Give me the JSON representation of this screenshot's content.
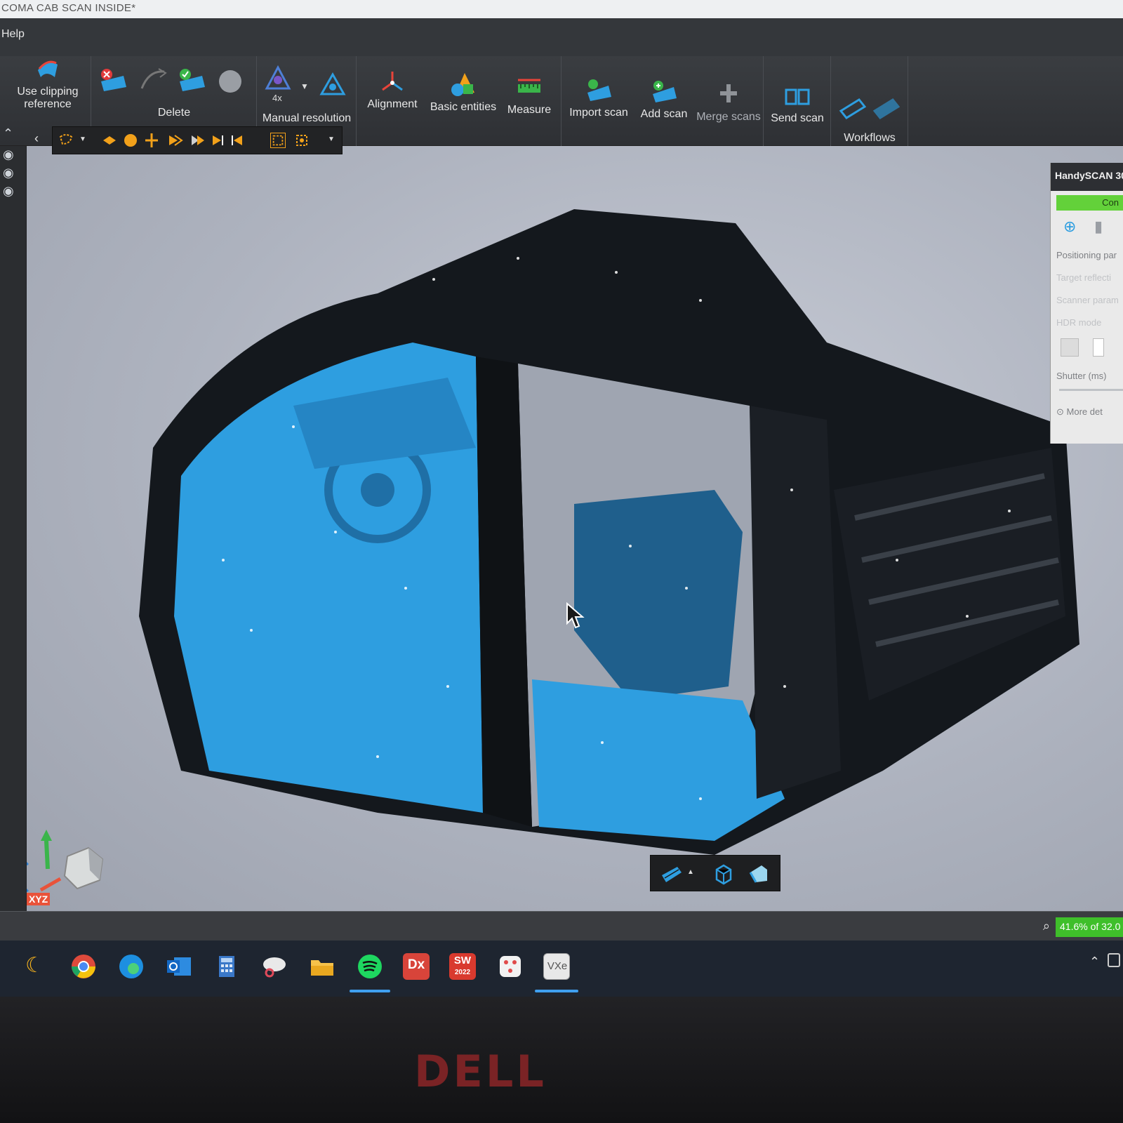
{
  "window": {
    "title": "COMA CAB SCAN INSIDE*"
  },
  "menu": {
    "help": "Help"
  },
  "ribbon": {
    "use_clipping_reference": "Use clipping reference",
    "delete_group": "Delete",
    "manual_resolution_group": "Manual resolution",
    "manual_resolution_badge": "4x",
    "alignment": "Alignment",
    "basic_entities": "Basic entities",
    "measure": "Measure",
    "import_scan": "Import scan",
    "add_scan": "Add scan",
    "merge_scans": "Merge scans",
    "send_scan": "Send scan",
    "workflows_group": "Workflows"
  },
  "scanner_panel": {
    "title": "HandySCAN 30",
    "connect": "Con",
    "positioning": "Positioning par",
    "target_reflect": "Target reflecti",
    "scanner_params": "Scanner param",
    "hdr_mode": "HDR mode",
    "shutter": "Shutter (ms)",
    "more_details": "More det"
  },
  "navcube": {
    "label": "XYZ"
  },
  "status": {
    "zoom_text": "41.6% of 32.0"
  },
  "taskbar": {
    "dx_label": "Dx",
    "sw_label": "SW",
    "sw_year": "2022",
    "vxe_label": "VXe"
  },
  "bezel": {
    "brand": "DELL"
  },
  "colors": {
    "scan_blue": "#2e9ee0",
    "scan_dark": "#14181d",
    "status_green": "#3fbf2a"
  }
}
